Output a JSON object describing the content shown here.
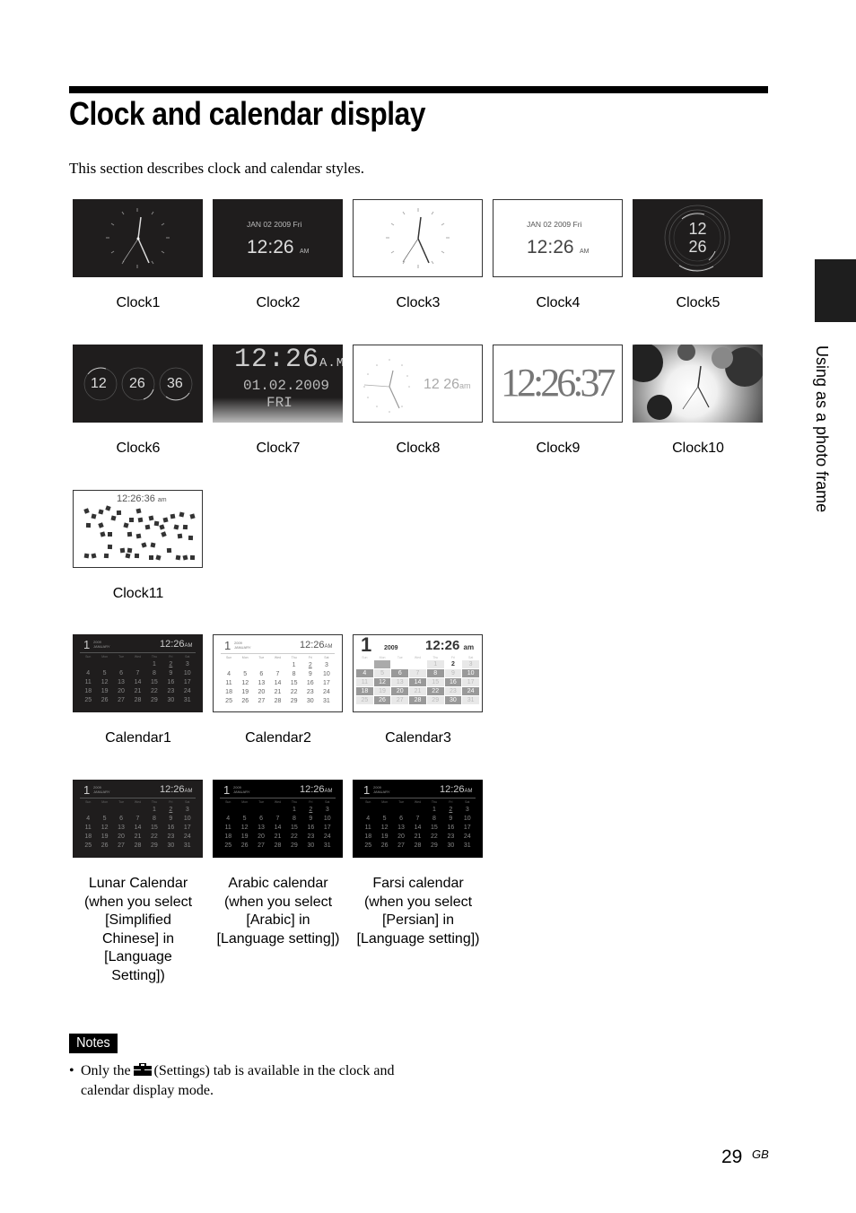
{
  "page": {
    "title": "Clock and calendar display",
    "intro": "This section describes clock and calendar styles.",
    "side_tab_label": "Using as a photo frame",
    "page_number": "29",
    "page_suffix": "GB"
  },
  "clocks": [
    {
      "caption": "Clock1",
      "style": "analog-dark"
    },
    {
      "caption": "Clock2",
      "style": "digital-dark",
      "date": "JAN 02 2009 Fri",
      "time": "12:26",
      "ampm": "AM"
    },
    {
      "caption": "Clock3",
      "style": "analog-light"
    },
    {
      "caption": "Clock4",
      "style": "digital-light",
      "date": "JAN 02 2009 Fri",
      "time": "12:26",
      "ampm": "AM"
    },
    {
      "caption": "Clock5",
      "style": "ring-dark",
      "hours": "12",
      "minutes": "26"
    },
    {
      "caption": "Clock6",
      "style": "three-rings",
      "hours": "12",
      "minutes": "26",
      "seconds": "36"
    },
    {
      "caption": "Clock7",
      "style": "dot-matrix",
      "time": "12:26",
      "ampm": "A.M.",
      "date": "01.02.2009",
      "day": "FRI"
    },
    {
      "caption": "Clock8",
      "style": "analog-with-text",
      "time": "12 26",
      "ampm": "am"
    },
    {
      "caption": "Clock9",
      "style": "large-serif",
      "time": "12:26:37"
    },
    {
      "caption": "Clock10",
      "style": "bokeh-analog"
    },
    {
      "caption": "Clock11",
      "style": "scattered-tiles",
      "time": "12:26:36",
      "ampm": "am"
    }
  ],
  "calendars": [
    {
      "caption": "Calendar1",
      "style": "dark"
    },
    {
      "caption": "Calendar2",
      "style": "light"
    },
    {
      "caption": "Calendar3",
      "style": "checker",
      "year": "2009",
      "time": "12:26",
      "ampm": "am"
    },
    {
      "caption_lines": [
        "Lunar Calendar",
        "(when you select",
        "[Simplified",
        "Chinese] in",
        "[Language",
        "Setting])"
      ],
      "style": "lunar"
    },
    {
      "caption_lines": [
        "Arabic calendar",
        "(when you select",
        "[Arabic] in",
        "[Language setting])"
      ],
      "style": "arabic"
    },
    {
      "caption_lines": [
        "Farsi calendar",
        "(when you select",
        "[Persian] in",
        "[Language setting])"
      ],
      "style": "farsi"
    }
  ],
  "calendar_common": {
    "month_num": "1",
    "year": "2009",
    "month_name": "JANUARY",
    "time": "12:26",
    "ampm": "AM",
    "weekdays": [
      "Sun",
      "Mon",
      "Tue",
      "Wed",
      "Thu",
      "Fri",
      "Sat"
    ],
    "days": [
      "",
      "",
      "",
      "",
      "1",
      "2",
      "3",
      "4",
      "5",
      "6",
      "7",
      "8",
      "9",
      "10",
      "11",
      "12",
      "13",
      "14",
      "15",
      "16",
      "17",
      "18",
      "19",
      "20",
      "21",
      "22",
      "23",
      "24",
      "25",
      "26",
      "27",
      "28",
      "29",
      "30",
      "31"
    ],
    "today": "2"
  },
  "notes": {
    "label": "Notes",
    "bullet": "•",
    "text_before": "Only the",
    "icon": "settings-toolbox-icon",
    "text_after": "(Settings) tab is available in the clock and calendar display mode."
  }
}
